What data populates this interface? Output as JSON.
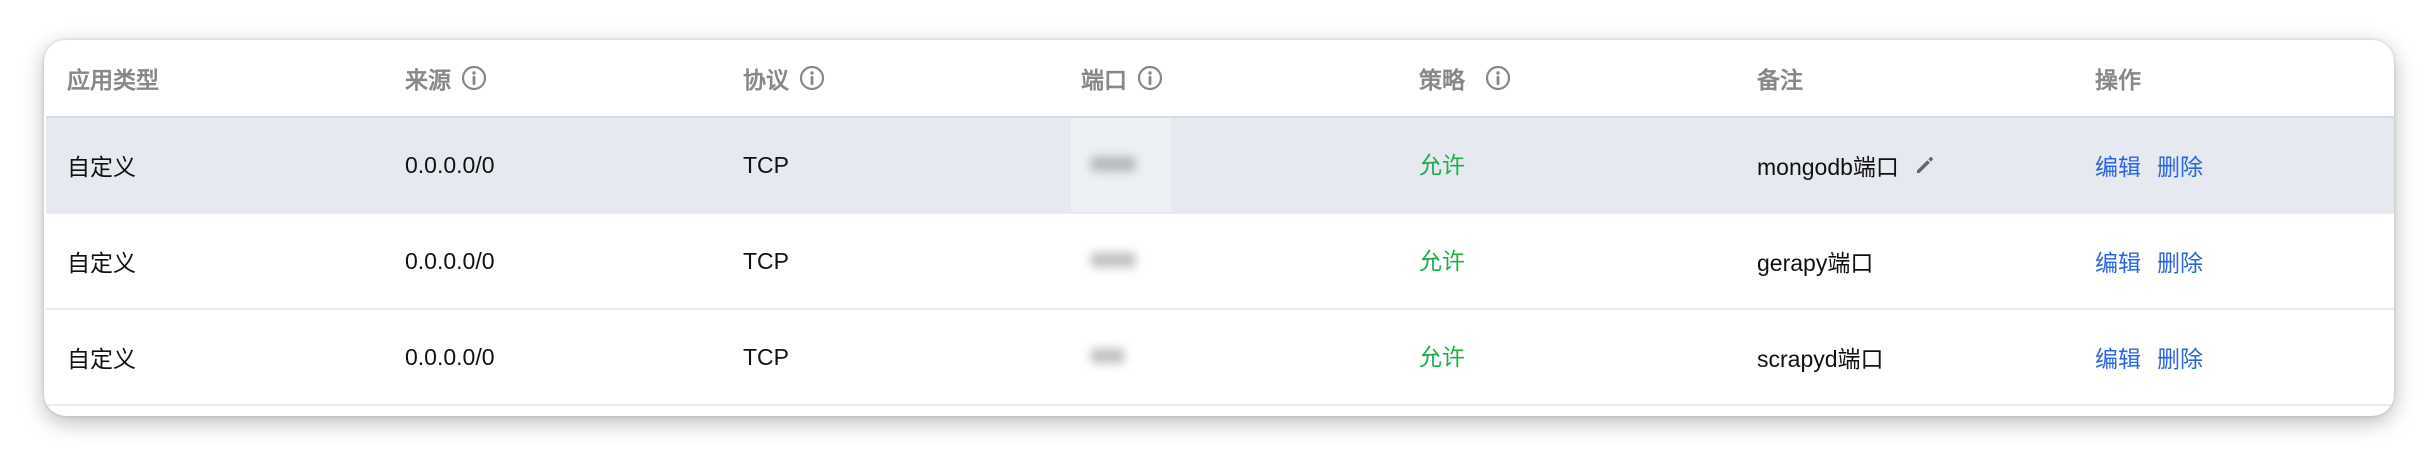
{
  "columns": {
    "app_type": "应用类型",
    "source": "来源",
    "protocol": "协议",
    "port": "端口",
    "policy": "策略",
    "remark": "备注",
    "actions": "操作"
  },
  "rows": [
    {
      "app_type": "自定义",
      "source": "0.0.0.0/0",
      "protocol": "TCP",
      "port": "8888",
      "policy": "允许",
      "remark": "mongodb端口",
      "edit_label": "编辑",
      "delete_label": "删除",
      "highlighted": true
    },
    {
      "app_type": "自定义",
      "source": "0.0.0.0/0",
      "protocol": "TCP",
      "port": "8888",
      "policy": "允许",
      "remark": "gerapy端口",
      "edit_label": "编辑",
      "delete_label": "删除",
      "highlighted": false
    },
    {
      "app_type": "自定义",
      "source": "0.0.0.0/0",
      "protocol": "TCP",
      "port": "888",
      "policy": "允许",
      "remark": "scrapyd端口",
      "edit_label": "编辑",
      "delete_label": "删除",
      "highlighted": false
    }
  ],
  "colors": {
    "allow": "#1fae4a",
    "link": "#2a66e0",
    "header_text": "#888888",
    "highlight_row": "#e6e9f0"
  },
  "icons": {
    "info": "info-circle-icon",
    "edit_remark": "pencil-icon"
  }
}
